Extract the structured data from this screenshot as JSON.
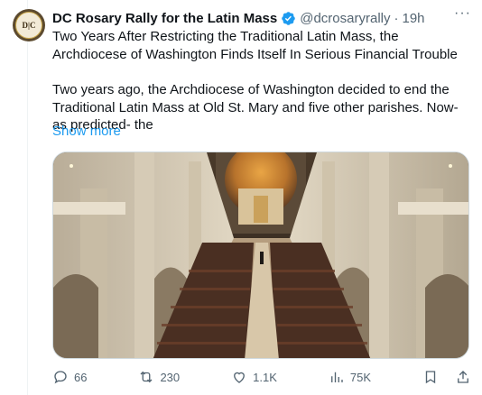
{
  "tweet": {
    "author_name": "DC Rosary Rally for the Latin Mass",
    "handle": "@dcrosaryrally",
    "separator": "·",
    "time": "19h",
    "avatar_text": "D|C",
    "paragraph1": "Two Years After Restricting the Traditional Latin Mass, the Archdiocese of Washington Finds Itself In Serious Financial Trouble",
    "paragraph2": "Two years ago, the Archdiocese of Washington decided to end the Traditional Latin Mass at Old St. Mary and five other parishes. Now- as predicted- the",
    "show_more": "Show more",
    "more_menu": "···"
  },
  "actions": {
    "replies": "66",
    "reposts": "230",
    "likes": "1.1K",
    "views": "75K"
  },
  "colors": {
    "accent": "#1d9bf0",
    "secondary_text": "#536471",
    "verified_badge": "#1d9bf0"
  },
  "icons": [
    "verified-badge-icon",
    "more-icon",
    "reply-icon",
    "repost-icon",
    "like-icon",
    "views-icon",
    "bookmark-icon",
    "share-icon"
  ]
}
